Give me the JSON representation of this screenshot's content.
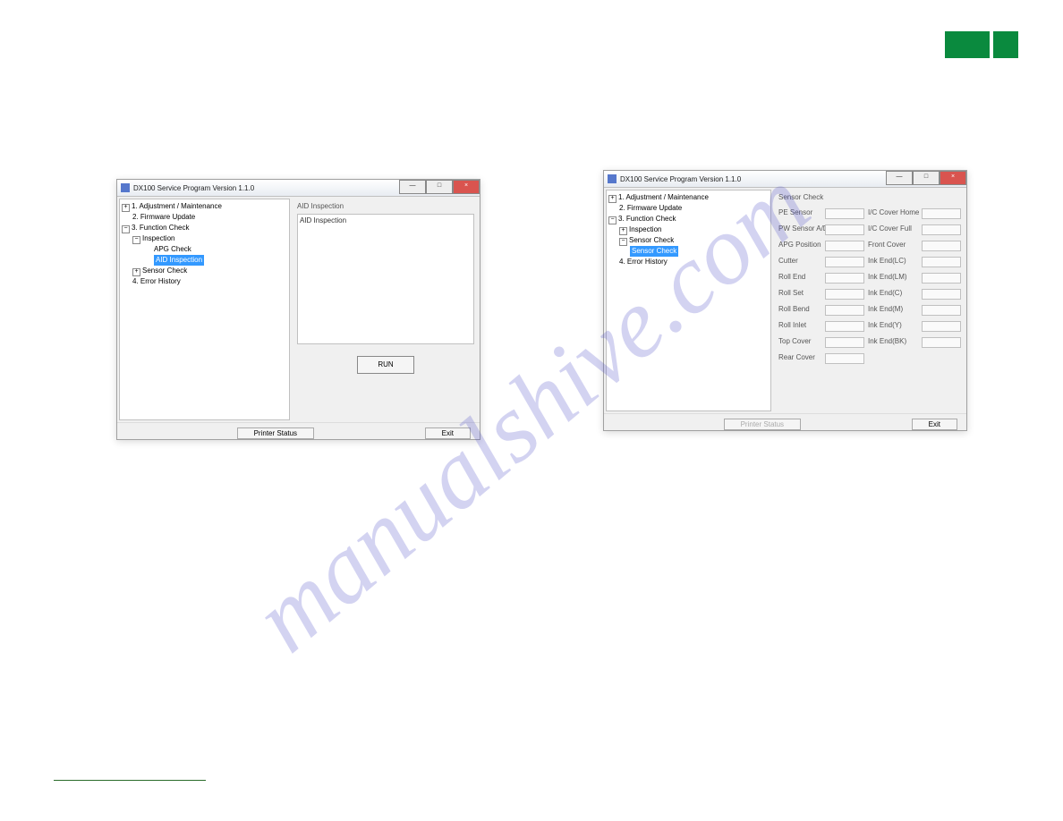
{
  "watermark": "manualshive.com",
  "window_title": "DX100 Service Program  Version 1.1.0",
  "tree": {
    "n1": "1. Adjustment / Maintenance",
    "n2": "2. Firmware Update",
    "n3": "3. Function Check",
    "n3_1": "Inspection",
    "n3_1_1": "APG Check",
    "n3_1_2": "AID Inspection",
    "n3_2": "Sensor Check",
    "n3_2_1": "Sensor Check",
    "n4": "4. Error History"
  },
  "panel1": {
    "title": "AID Inspection",
    "output_label": "AID Inspection",
    "run": "RUN"
  },
  "panel2": {
    "title": "Sensor Check",
    "left": [
      "PE Sensor",
      "PW Sensor A/D",
      "APG Position",
      "Cutter",
      "Roll End",
      "Roll Set",
      "Roll Bend",
      "Roll Inlet",
      "Top Cover",
      "Rear Cover"
    ],
    "right": [
      "I/C Cover Home",
      "I/C Cover Full",
      "Front Cover",
      "Ink End(LC)",
      "Ink End(LM)",
      "Ink End(C)",
      "Ink End(M)",
      "Ink End(Y)",
      "Ink End(BK)"
    ]
  },
  "buttons": {
    "printer_status": "Printer Status",
    "exit": "Exit"
  }
}
